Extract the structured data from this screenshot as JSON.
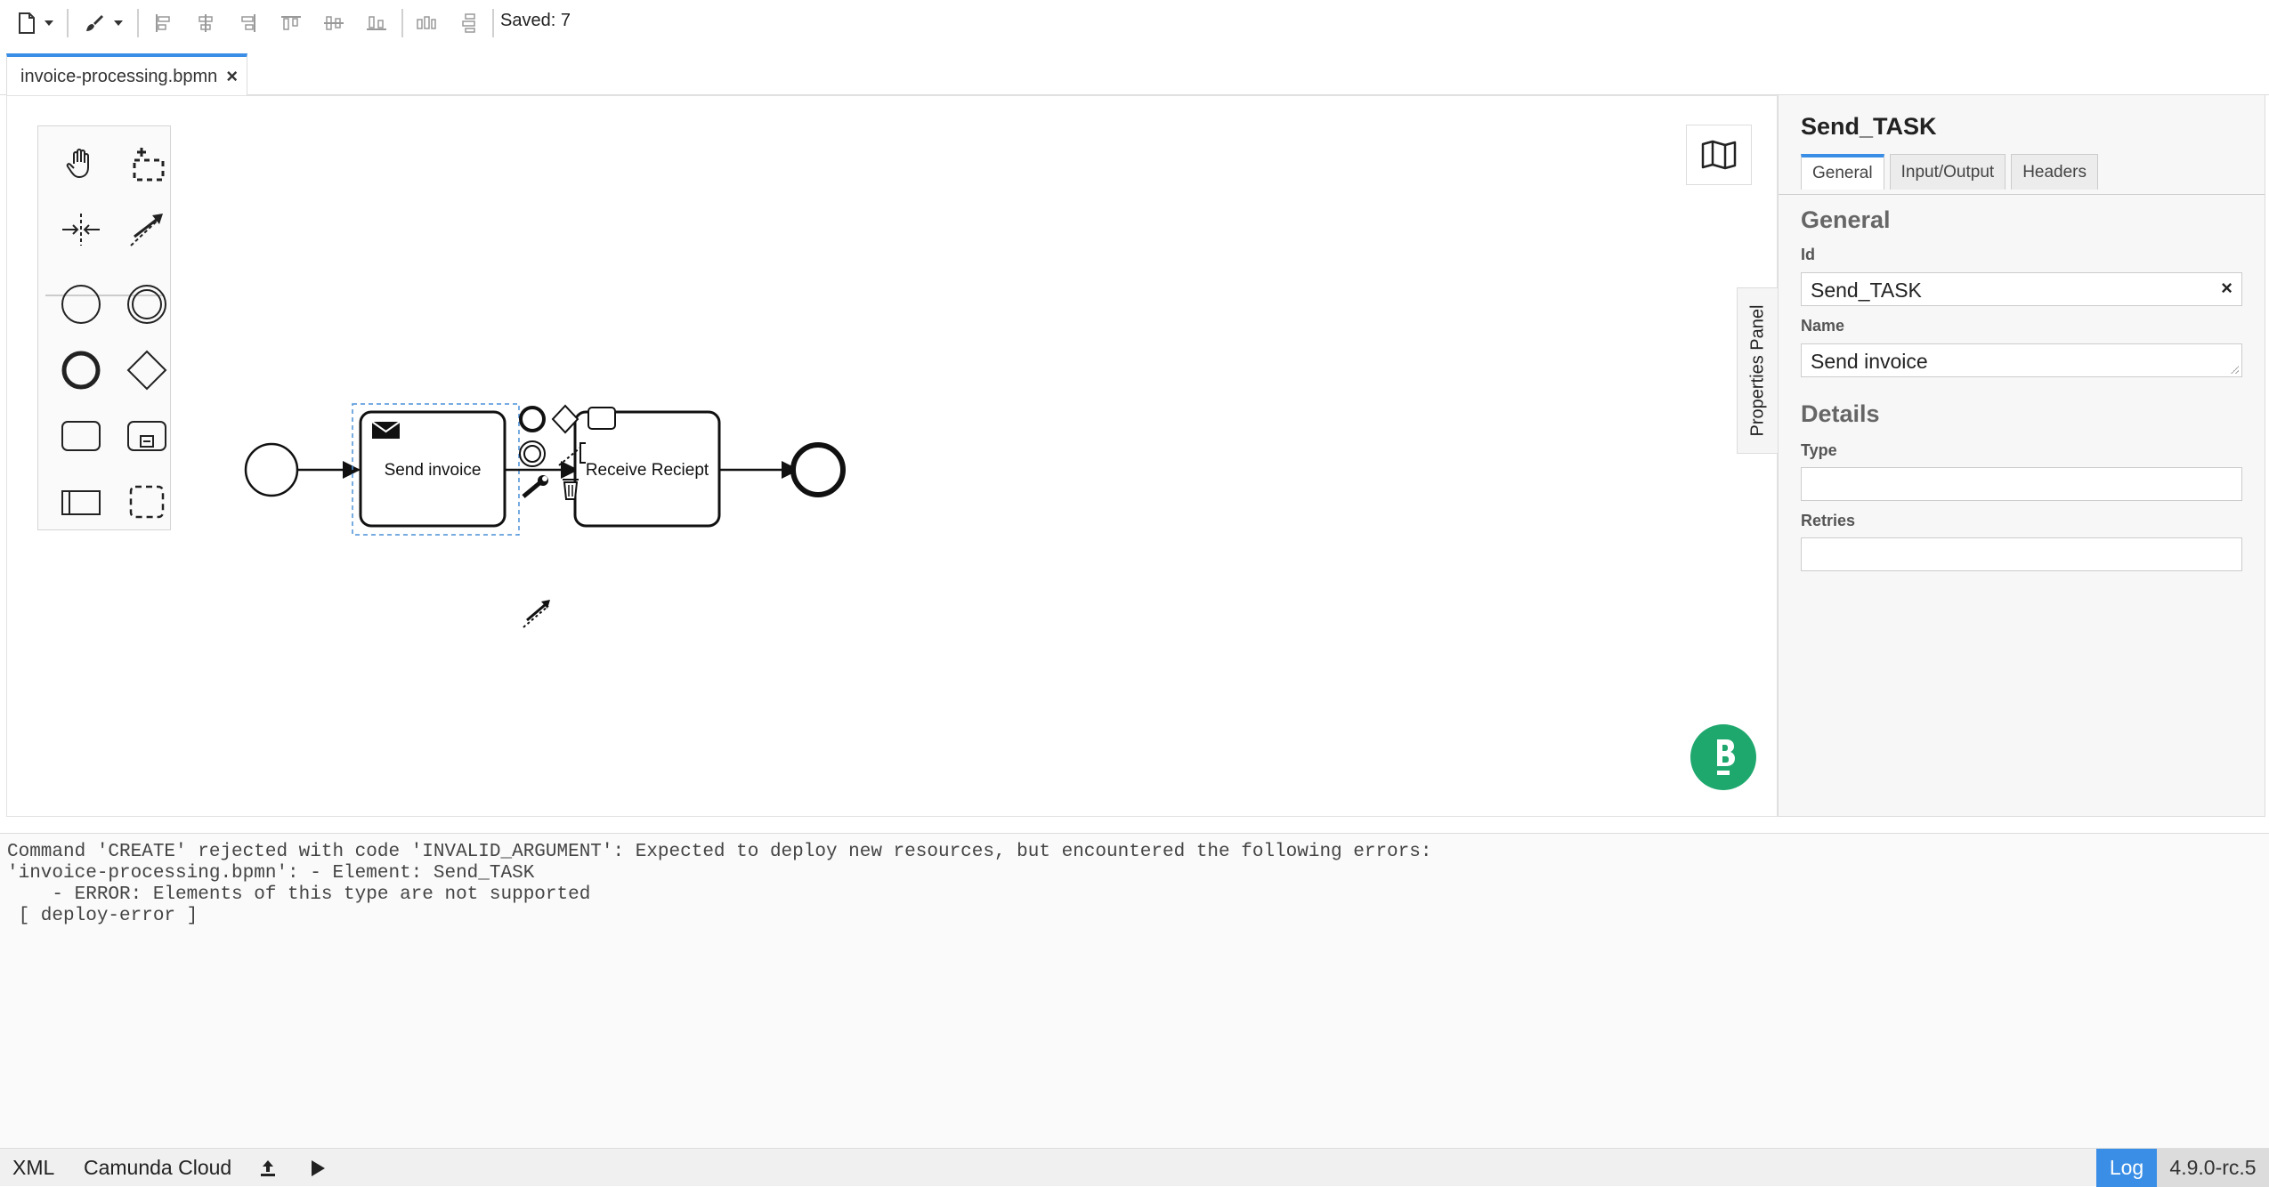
{
  "toolbar": {
    "saved_label": "Saved: 7",
    "icons": [
      "new-file-icon",
      "chevron-down-icon",
      "paint-brush-icon",
      "chevron-down-icon",
      "align-left-icon",
      "align-center-icon",
      "align-right-icon",
      "align-top-icon",
      "align-middle-icon",
      "align-bottom-icon",
      "distribute-horizontal-icon",
      "distribute-vertical-icon"
    ]
  },
  "tabs": [
    {
      "label": "invoice-processing.bpmn",
      "close": "×"
    }
  ],
  "palette": {
    "tools": [
      "hand-tool",
      "lasso-tool",
      "space-tool",
      "global-connect-tool",
      "start-event",
      "intermediate-event",
      "end-event",
      "gateway",
      "task",
      "subprocess",
      "pool",
      "group"
    ]
  },
  "diagram": {
    "tasks": [
      {
        "label": "Send invoice",
        "type": "send-task",
        "selected": true
      },
      {
        "label": "Receive Reciept",
        "type": "task"
      }
    ]
  },
  "properties_toggle_label": "Properties Panel",
  "properties": {
    "title": "Send_TASK",
    "tabs": [
      "General",
      "Input/Output",
      "Headers"
    ],
    "active_tab": "General",
    "general_section": "General",
    "id_label": "Id",
    "id_value": "Send_TASK",
    "id_clear": "×",
    "name_label": "Name",
    "name_value": "Send invoice",
    "details_section": "Details",
    "type_label": "Type",
    "type_value": "",
    "retries_label": "Retries",
    "retries_value": ""
  },
  "log": {
    "lines": [
      "Command 'CREATE' rejected with code 'INVALID_ARGUMENT': Expected to deploy new resources, but encountered the following errors:",
      "'invoice-processing.bpmn': - Element: Send_TASK",
      "    - ERROR: Elements of this type are not supported",
      " [ deploy-error ]"
    ]
  },
  "statusbar": {
    "xml": "XML",
    "platform": "Camunda Cloud",
    "log": "Log",
    "version": "4.9.0-rc.5"
  },
  "colors": {
    "accent": "#3a8ee6",
    "bpmn_logo": "#1fa86e"
  }
}
